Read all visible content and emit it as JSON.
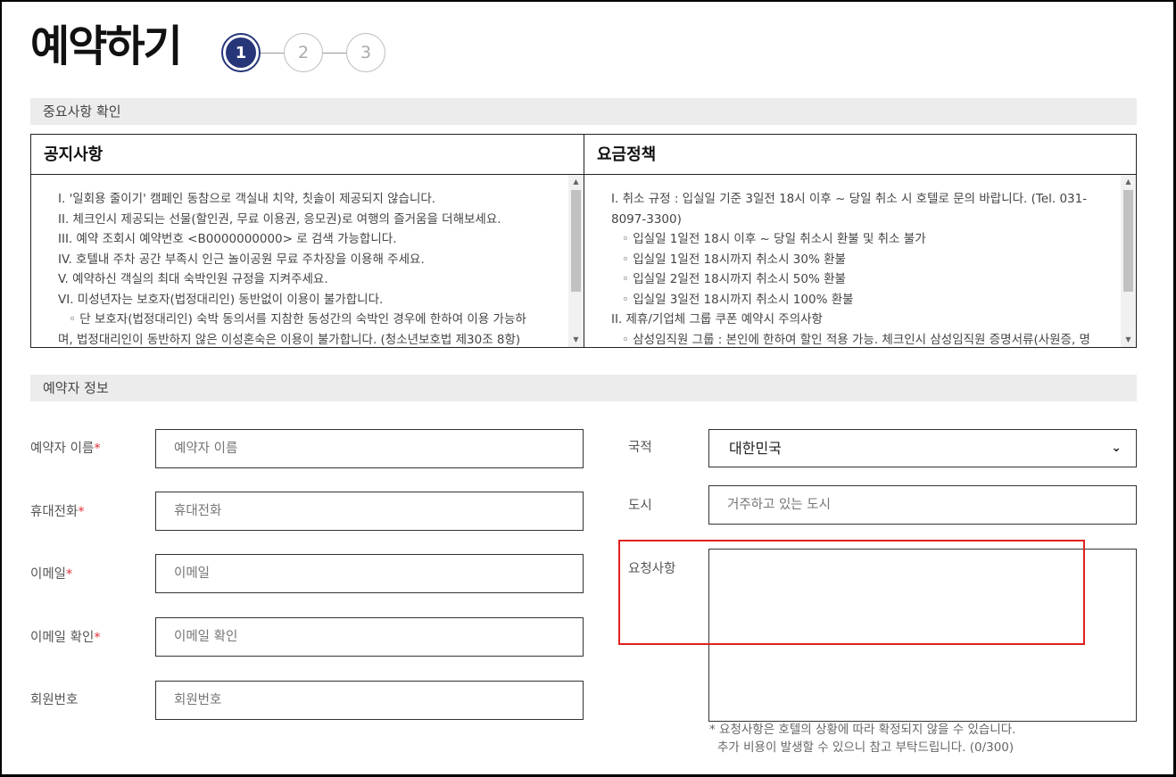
{
  "page": {
    "title": "예약하기"
  },
  "steps": [
    "1",
    "2",
    "3"
  ],
  "sections": {
    "important": "중요사항 확인",
    "booker": "예약자 정보"
  },
  "notice": {
    "title": "공지사항",
    "lines": [
      "I. '일회용 줄이기' 캠페인 동참으로 객실내 치약, 칫솔이 제공되지 않습니다.",
      "II. 체크인시 제공되는 선물(할인권, 무료 이용권, 응모권)로 여행의 즐거움을 더해보세요.",
      "III. 예약 조회시 예약번호 <B0000000000> 로 검색 가능합니다.",
      "IV. 호텔내 주차 공간 부족시 인근 놀이공원 무료 주차장을 이용해 주세요.",
      "V. 예약하신 객실의 최대 숙박인원 규정을 지켜주세요.",
      "VI. 미성년자는 보호자(법정대리인) 동반없이 이용이 불가합니다.",
      "◦   단 보호자(법정대리인) 숙박 동의서를 지참한 동성간의 숙박인 경우에 한하여 이용 가능하",
      "며, 법정대리인이 동반하지 않은 이성혼숙은 이용이 불가합니다. (청소년보호법 제30조 8항)"
    ]
  },
  "policy": {
    "title": "요금정책",
    "lines": [
      "I. 취소 규정 : 입실일 기준 3일전 18시 이후 ~ 당일 취소 시 호텔로 문의 바랍니다. (Tel. 031-",
      "8097-3300)",
      "◦   입실일 1일전 18시 이후 ~ 당일 취소시 환불 및 취소 불가",
      "◦   입실일 1일전 18시까지 취소시 30% 환불",
      "◦   입실일 2일전 18시까지 취소시 50% 환불",
      "◦   입실일 3일전 18시까지 취소시 100% 환불",
      "II.  제휴/기업체 그룹 쿠폰 예약시 주의사항",
      "◦   삼성임직원 그룹 : 본인에 한하여 할인 적용 가능. 체크인시 삼성임직원 증명서류(사원증, 명"
    ]
  },
  "form": {
    "name": {
      "label": "예약자 이름",
      "required": "*",
      "placeholder": "예약자 이름"
    },
    "phone": {
      "label": "휴대전화",
      "required": "*",
      "placeholder": "휴대전화"
    },
    "email": {
      "label": "이메일",
      "required": "*",
      "placeholder": "이메일"
    },
    "email_confirm": {
      "label": "이메일 확인",
      "required": "*",
      "placeholder": "이메일 확인"
    },
    "member": {
      "label": "회원번호",
      "placeholder": "회원번호"
    },
    "nationality": {
      "label": "국적",
      "value": "대한민국"
    },
    "city": {
      "label": "도시",
      "placeholder": "거주하고 있는 도시"
    },
    "request": {
      "label": "요청사항",
      "hint_1": "* 요청사항은 호텔의 상황에 따라 확정되지 않을 수 있습니다.",
      "hint_2": "추가 비용이 발생할 수 있으니 참고 부탁드립니다. (0/300)"
    }
  },
  "colors": {
    "accent": "#263679",
    "required": "#e0313b",
    "highlight": "#e02020"
  }
}
